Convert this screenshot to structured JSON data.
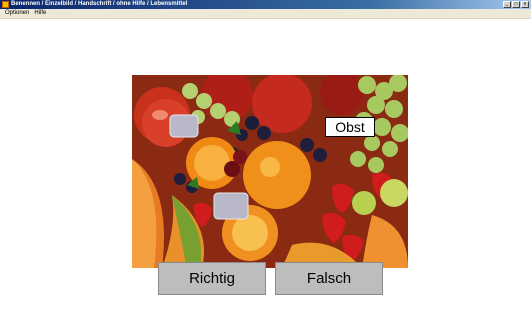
{
  "window": {
    "title": "Benennen / Einzelbild / Handschrift / ohne Hilfe / Lebensmittel",
    "controls": {
      "minimize": "_",
      "maximize": "□",
      "close": "x"
    }
  },
  "menu": [
    {
      "label": "Optionen"
    },
    {
      "label": "Hilfe"
    }
  ],
  "picture": {
    "label": "Obst"
  },
  "buttons": {
    "richtig": "Richtig",
    "falsch": "Falsch"
  },
  "colors": {
    "titlebar": "#0a246a",
    "button": "#bdbdbd"
  }
}
